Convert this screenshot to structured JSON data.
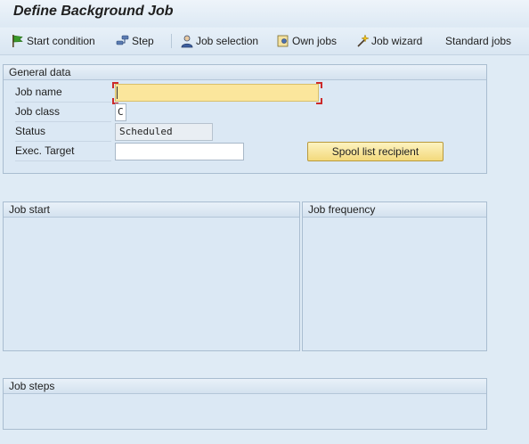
{
  "window": {
    "title": "Define Background Job"
  },
  "toolbar": {
    "start_condition": "Start condition",
    "step": "Step",
    "job_selection": "Job selection",
    "own_jobs": "Own jobs",
    "job_wizard": "Job wizard",
    "standard_jobs": "Standard jobs"
  },
  "general_data": {
    "title": "General data",
    "job_name": {
      "label": "Job name",
      "value": ""
    },
    "job_class": {
      "label": "Job class",
      "value": "C"
    },
    "status": {
      "label": "Status",
      "value": "Scheduled"
    },
    "exec_target": {
      "label": "Exec. Target",
      "value": ""
    },
    "spool_button": "Spool list recipient"
  },
  "panels": {
    "job_start": "Job start",
    "job_frequency": "Job frequency",
    "job_steps": "Job steps"
  },
  "colors": {
    "background": "#dfebf5",
    "focused_field": "#fbe69c",
    "button": "#f3d97c"
  }
}
